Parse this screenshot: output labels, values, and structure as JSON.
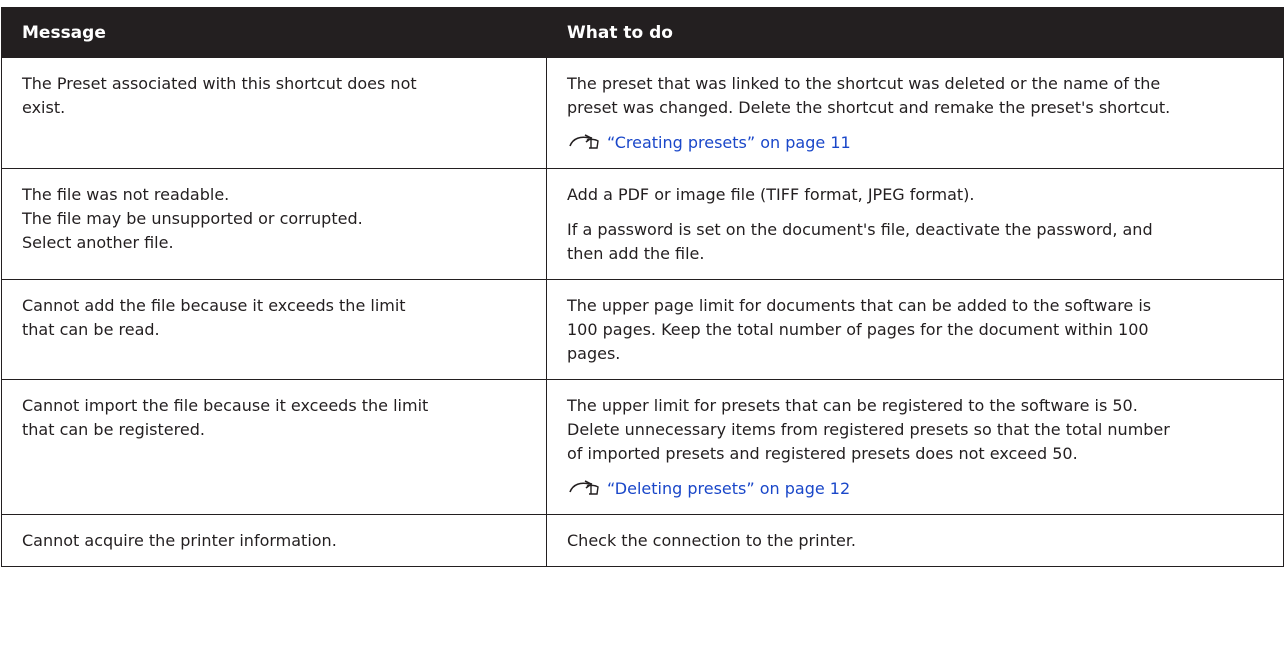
{
  "table": {
    "headers": [
      "Message",
      "What to do"
    ],
    "rows": [
      {
        "message": [
          "The Preset associated with this shortcut does not",
          "exist."
        ],
        "what": [
          {
            "type": "text",
            "lines": [
              "The preset that was linked to the shortcut was deleted or the name of the",
              "preset was changed. Delete the shortcut and remake the preset's shortcut."
            ]
          },
          {
            "type": "link",
            "text": "“Creating presets” on page 11"
          }
        ]
      },
      {
        "message": [
          "The file was not readable.",
          "The file may be unsupported or corrupted.",
          "Select another file."
        ],
        "what": [
          {
            "type": "text",
            "lines": [
              "Add a PDF or image file (TIFF format, JPEG format)."
            ]
          },
          {
            "type": "text",
            "lines": [
              "If a password is set on the document's file, deactivate the password, and",
              "then add the file."
            ]
          }
        ]
      },
      {
        "message": [
          "Cannot add the file because it exceeds the limit",
          "that can be read."
        ],
        "what": [
          {
            "type": "text",
            "lines": [
              "The upper page limit for documents that can be added to the software is",
              "100 pages. Keep the total number of pages for the document within 100",
              "pages."
            ]
          }
        ]
      },
      {
        "message": [
          "Cannot import the file because it exceeds the limit",
          "that can be registered."
        ],
        "what": [
          {
            "type": "text",
            "lines": [
              "The upper limit for presets that can be registered to the software is 50.",
              "Delete unnecessary items from registered presets so that the total number",
              "of imported presets and registered presets does not exceed 50."
            ]
          },
          {
            "type": "link",
            "text": "“Deleting presets” on page 12"
          }
        ]
      },
      {
        "message": [
          "Cannot acquire the printer information."
        ],
        "what": [
          {
            "type": "text",
            "lines": [
              "Check the connection to the printer."
            ]
          }
        ]
      }
    ]
  },
  "colors": {
    "header_bg": "#231f20",
    "header_text": "#ffffff",
    "link": "#1a47c9",
    "border": "#231f20"
  },
  "icons": {
    "reference": "reference-arrow-icon"
  }
}
